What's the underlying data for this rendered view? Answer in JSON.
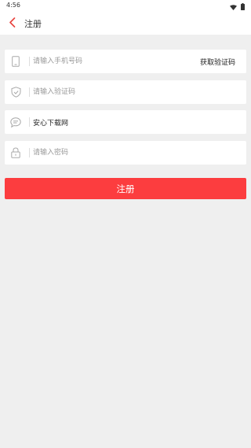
{
  "status_bar": {
    "time": "4:56",
    "icons": [
      "wifi-icon",
      "battery-icon"
    ]
  },
  "app_bar": {
    "title": "注册",
    "back_icon": "chevron-left-icon",
    "accent_color": "#e8433e"
  },
  "form": {
    "phone": {
      "placeholder": "请输入手机号码",
      "icon": "phone-icon",
      "action_label": "获取验证码"
    },
    "code": {
      "placeholder": "请输入验证码",
      "icon": "shield-icon"
    },
    "invite": {
      "value": "安心下载网",
      "icon": "chat-bubble-icon"
    },
    "password": {
      "placeholder": "请输入密码",
      "icon": "lock-icon"
    }
  },
  "submit": {
    "label": "注册",
    "color": "#fc3d3f"
  }
}
